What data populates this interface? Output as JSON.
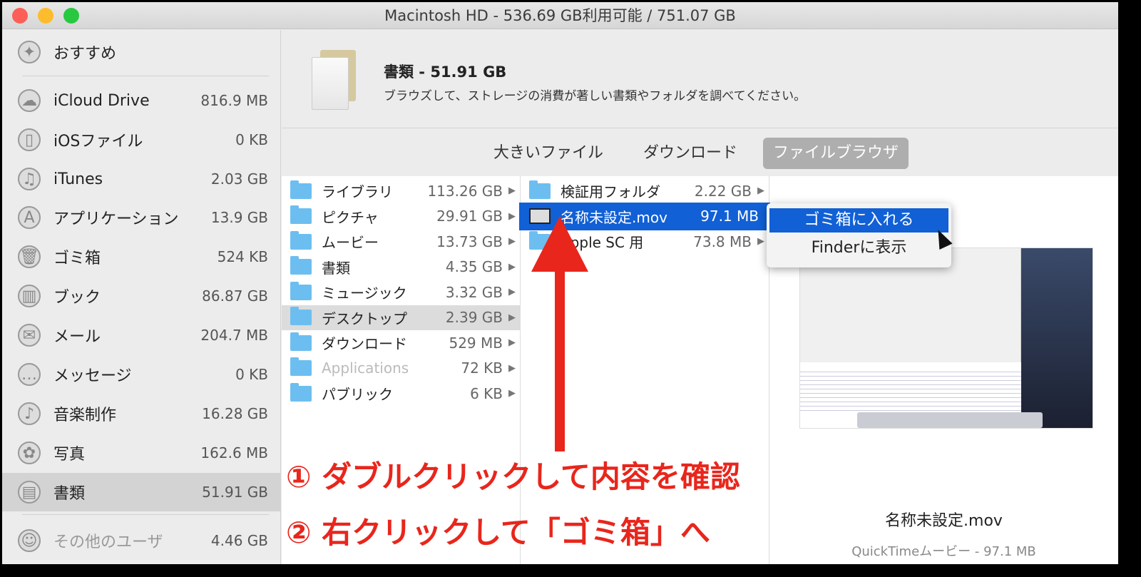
{
  "window": {
    "title": "Macintosh HD - 536.69 GB利用可能 / 751.07 GB"
  },
  "sidebar": {
    "items": [
      {
        "label": "おすすめ",
        "size": "",
        "icon": "lightbulb-icon"
      },
      {
        "label": "iCloud Drive",
        "size": "816.9 MB",
        "icon": "cloud-icon"
      },
      {
        "label": "iOSファイル",
        "size": "0 KB",
        "icon": "iphone-icon"
      },
      {
        "label": "iTunes",
        "size": "2.03 GB",
        "icon": "music-note-icon"
      },
      {
        "label": "アプリケーション",
        "size": "13.9 GB",
        "icon": "app-store-icon"
      },
      {
        "label": "ゴミ箱",
        "size": "524 KB",
        "icon": "trash-icon"
      },
      {
        "label": "ブック",
        "size": "86.87 GB",
        "icon": "book-icon"
      },
      {
        "label": "メール",
        "size": "204.7 MB",
        "icon": "mail-icon"
      },
      {
        "label": "メッセージ",
        "size": "0 KB",
        "icon": "messages-icon"
      },
      {
        "label": "音楽制作",
        "size": "16.28 GB",
        "icon": "guitar-icon"
      },
      {
        "label": "写真",
        "size": "162.6 MB",
        "icon": "photos-icon"
      },
      {
        "label": "書類",
        "size": "51.91 GB",
        "icon": "documents-icon"
      },
      {
        "label": "その他のユーザ",
        "size": "4.46 GB",
        "icon": "users-icon"
      }
    ]
  },
  "header": {
    "title": "書類 - 51.91 GB",
    "description": "ブラウズして、ストレージの消費が著しい書類やフォルダを調べてください。"
  },
  "tabs": [
    "大きいファイル",
    "ダウンロード",
    "ファイルブラウザ"
  ],
  "column1": [
    {
      "label": "ライブラリ",
      "size": "113.26 GB"
    },
    {
      "label": "ピクチャ",
      "size": "29.91 GB"
    },
    {
      "label": "ムービー",
      "size": "13.73 GB"
    },
    {
      "label": "書類",
      "size": "4.35 GB"
    },
    {
      "label": "ミュージック",
      "size": "3.32 GB"
    },
    {
      "label": "デスクトップ",
      "size": "2.39 GB"
    },
    {
      "label": "ダウンロード",
      "size": "529 MB"
    },
    {
      "label": "Applications",
      "size": "72 KB"
    },
    {
      "label": "パブリック",
      "size": "6 KB"
    }
  ],
  "column2": [
    {
      "label": "検証用フォルダ",
      "size": "2.22 GB"
    },
    {
      "label": "名称未設定.mov",
      "size": "97.1 MB"
    },
    {
      "label": "Apple SC 用",
      "size": "73.8 MB"
    }
  ],
  "context_menu": [
    "ゴミ箱に入れる",
    "Finderに表示"
  ],
  "preview": {
    "name": "名称未設定.mov",
    "kind": "QuickTimeムービー - 97.1 MB"
  },
  "annotations": [
    "① ダブルクリックして内容を確認",
    "② 右クリックして「ゴミ箱」へ"
  ],
  "colors": {
    "accent": "#1160d6",
    "annotation": "#e8261c"
  }
}
